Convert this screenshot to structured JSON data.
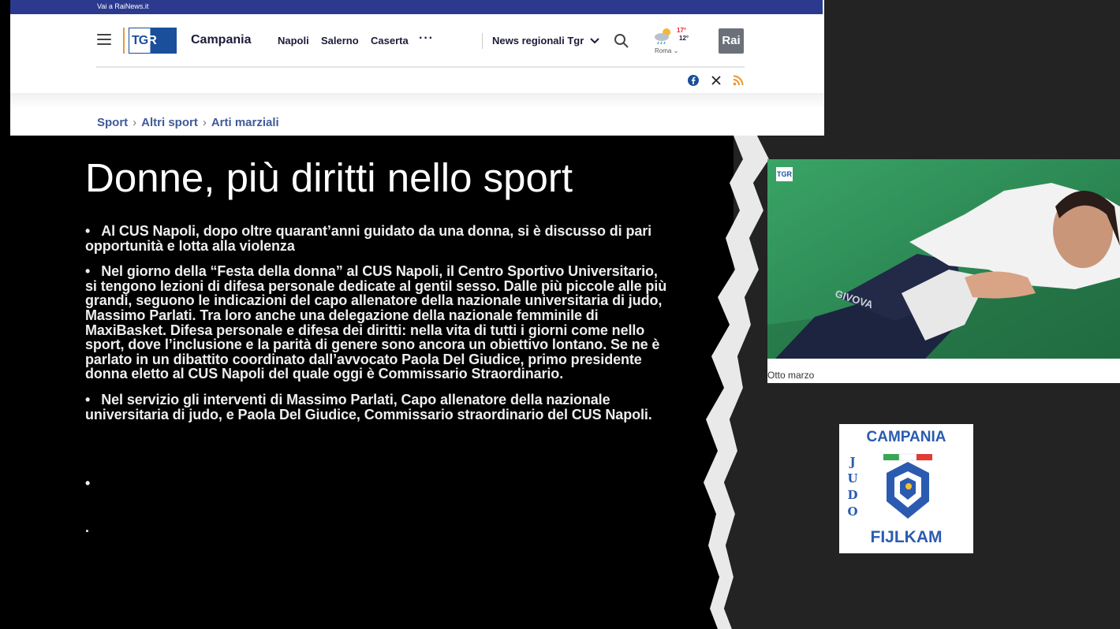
{
  "site": {
    "topbar_link": "Vai a RaiNews.it",
    "logo_text_a": "TG",
    "logo_text_b": "R",
    "region": "Campania",
    "nav": [
      "Napoli",
      "Salerno",
      "Caserta"
    ],
    "more": "···",
    "news_select": "News regionali Tgr",
    "weather": {
      "max": "17°",
      "min": "12°",
      "city": "Roma"
    },
    "rai_logo": "Rai",
    "breadcrumbs": [
      "Sport",
      "Altri sport",
      "Arti marziali"
    ]
  },
  "slide": {
    "title": "Donne, più diritti nello sport",
    "bullets": [
      "Al CUS Napoli, dopo oltre quarant’anni guidato da una donna, si è discusso di pari opportunità e lotta alla violenza",
      "Nel giorno della “Festa della donna” al CUS Napoli, il Centro Sportivo Universitario, si tengono lezioni di difesa personale dedicate al gentil sesso. Dalle più piccole alle più grandi, seguono le indicazioni del capo allenatore della nazionale universitaria di judo, Massimo Parlati. Tra loro anche una delegazione della nazionale femminile di MaxiBasket. Difesa personale e difesa dei diritti: nella vita di tutti i giorni come nello sport, dove l’inclusione e la parità di genere sono ancora un obiettivo lontano. Se ne è parlato in un dibattito coordinato dall’avvocato Paola Del Giudice, primo presidente donna eletto al CUS Napoli del quale oggi è Commissario Straordinario.",
      "Nel servizio gli interventi di Massimo Parlati, Capo allenatore della nazionale universitaria di judo, e Paola Del Giudice, Commissario straordinario del CUS Napoli."
    ],
    "bullet_char": "•",
    "trailing_bullet": "•",
    "trailing_dot": "."
  },
  "photo": {
    "badge": "TGR",
    "caption": "Otto marzo",
    "shirt_text": "GIVOVA"
  },
  "fijlkam": {
    "top": "CAMPANIA",
    "side": [
      "J",
      "U",
      "D",
      "O"
    ],
    "bottom": "FIJLKAM"
  }
}
